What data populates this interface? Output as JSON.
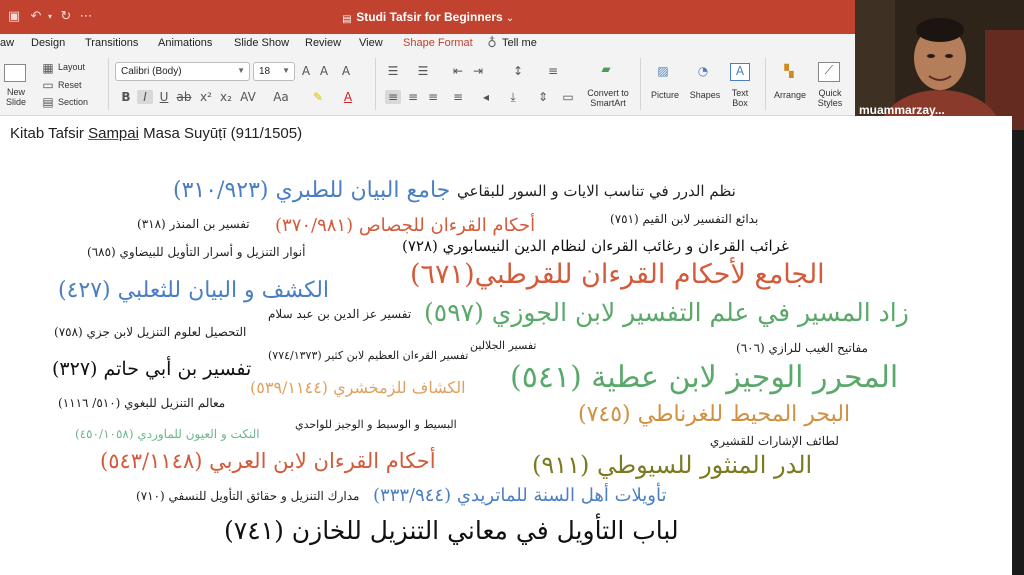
{
  "window": {
    "title": "Studi Tafsir for Beginners",
    "title_chevron": "⌄"
  },
  "menu": {
    "tabs": [
      "aw",
      "Design",
      "Transitions",
      "Animations",
      "Slide Show",
      "Review",
      "View",
      "Shape Format",
      "Tell me"
    ],
    "active_tab": "Shape Format"
  },
  "ribbon": {
    "new_slide": "New\nSlide",
    "layout": "Layout",
    "reset": "Reset",
    "section": "Section",
    "font_name": "Calibri (Body)",
    "font_size": "18",
    "convert_smartart": "Convert to\nSmartArt",
    "picture": "Picture",
    "shapes": "Shapes",
    "text_box": "Text\nBox",
    "arrange": "Arrange",
    "quick_styles": "Quick\nStyles"
  },
  "webcam": {
    "participant_name": "muammarzay..."
  },
  "slide": {
    "title_prefix": "Kitab Tafsir ",
    "title_underlined": "Sampai",
    "title_suffix": " Masa Suyūṭī (911/1505)",
    "items": [
      {
        "text": "نظم الدرر في تناسب الايات و السور للبقاعي",
        "color": "#222222"
      },
      {
        "text": "جامع البيان للطبري (٣١٠/٩٢٣)",
        "color": "#4a7fc1"
      },
      {
        "text": "تفسير بن المنذر (٣١٨)",
        "color": "#222222"
      },
      {
        "text": "أحكام القرءان للجصاص (٣٧٠/٩٨١)",
        "color": "#d35a3a"
      },
      {
        "text": "بدائع التفسير لابن القيم (٧٥١)",
        "color": "#222222"
      },
      {
        "text": "أنوار التنزيل و أسرار التأويل للبيضاوي (٦٨٥)",
        "color": "#222222"
      },
      {
        "text": "غرائب القرءان و رغائب القرءان لنظام الدين النيسابوري (٧٢٨)",
        "color": "#111111"
      },
      {
        "text": "الجامع لأحكام القرءان للقرطبي(٦٧١)",
        "color": "#d35a3a"
      },
      {
        "text": "الكشف و البيان للثعلبي (٤٢٧)",
        "color": "#4a7fc1"
      },
      {
        "text": "تفسير عز الدين بن عبد سلام",
        "color": "#222222"
      },
      {
        "text": "زاد المسير في علم التفسير لابن الجوزي (٥٩٧)",
        "color": "#5aa86a"
      },
      {
        "text": "التحصيل لعلوم التنزيل لابن جزي (٧٥٨)",
        "color": "#222222"
      },
      {
        "text": "تفسير الجلالين",
        "color": "#222222"
      },
      {
        "text": "مفاتيح الغيب للرازي (٦٠٦)",
        "color": "#222222"
      },
      {
        "text": "تفسير القرءان العظيم لابن كثير (٧٧٤/١٣٧٣)",
        "color": "#222222"
      },
      {
        "text": "تفسير بن أبي حاتم (٣٢٧)",
        "color": "#111111"
      },
      {
        "text": "الكشاف للزمخشري (٥٣٩/١١٤٤)",
        "color": "#e0a060"
      },
      {
        "text": "المحرر الوجيز لابن عطية (٥٤١)",
        "color": "#5aa86a"
      },
      {
        "text": "معالم التنزيل للبغوي (٥١٠/ ١١١٦)",
        "color": "#222222"
      },
      {
        "text": "البحر المحيط للغرناطي (٧٤٥)",
        "color": "#d09040"
      },
      {
        "text": "البسيط و الوسيط و الوجيز للواحدي",
        "color": "#222222"
      },
      {
        "text": "النكت و العيون للماوردي (٤٥٠/١٠٥٨)",
        "color": "#6cb88a"
      },
      {
        "text": "لطائف الإشارات للقشيري",
        "color": "#222222"
      },
      {
        "text": "أحكام القرءان لابن العربي (٥٤٣/١١٤٨)",
        "color": "#d35a3a"
      },
      {
        "text": "الدر المنثور للسيوطي (٩١١)",
        "color": "#7a7a20"
      },
      {
        "text": "مدارك التنزيل و حقائق التأويل للنسفي (٧١٠)",
        "color": "#222222"
      },
      {
        "text": "تأويلات أهل السنة للماتريدي (٣٣٣/٩٤٤)",
        "color": "#4a7fc1"
      },
      {
        "text": "لباب التأويل في معاني التنزيل للخازن (٧٤١)",
        "color": "#111111"
      }
    ]
  },
  "colors": {
    "titlebar": "#c0422f",
    "accent": "#c0422f"
  }
}
